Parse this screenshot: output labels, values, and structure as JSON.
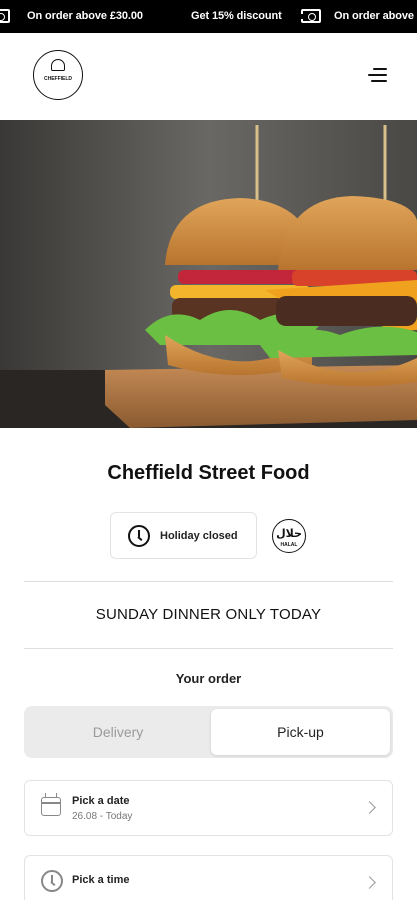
{
  "promo": {
    "messages": [
      "On order above £30.00",
      "Get 15% discount",
      "On order above"
    ]
  },
  "header": {
    "logo_icon": "chef-hat-logo",
    "logo_text": "CHEFFIELD",
    "menu_icon": "hamburger-menu-icon"
  },
  "hero": {
    "description_icon": "burger-photo"
  },
  "restaurant": {
    "name": "Cheffield Street Food",
    "status": "Holiday closed",
    "halal_arabic": "حلال",
    "halal_english": "HALAL"
  },
  "notice": "SUNDAY DINNER ONLY TODAY",
  "order": {
    "heading": "Your order",
    "modes": [
      {
        "label": "Delivery",
        "selected": false
      },
      {
        "label": "Pick-up",
        "selected": true
      }
    ],
    "date": {
      "label": "Pick a date",
      "value": "26.08 - Today",
      "icon": "calendar-icon"
    },
    "time": {
      "label": "Pick a time",
      "icon": "clock-icon"
    }
  },
  "colors": {
    "promo_bg": "#000000",
    "accent": "#111111",
    "muted": "#9a9a9a",
    "toggle_bg": "#ebebeb"
  }
}
